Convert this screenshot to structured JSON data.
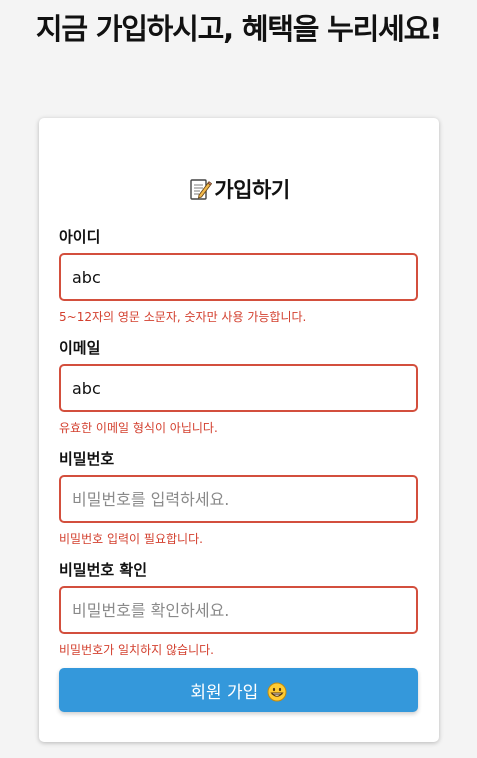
{
  "page": {
    "headline": "지금 가입하시고, 혜택을 누리세요!"
  },
  "signup_form": {
    "title_icon": "memo-icon",
    "title": "가입하기",
    "fields": [
      {
        "label": "아이디",
        "value": "abc",
        "placeholder": "",
        "error": "5~12자의 영문 소문자, 숫자만 사용 가능합니다."
      },
      {
        "label": "이메일",
        "value": "abc",
        "placeholder": "",
        "error": "유효한 이메일 형식이 아닙니다."
      },
      {
        "label": "비밀번호",
        "value": "",
        "placeholder": "비밀번호를 입력하세요.",
        "error": "비밀번호 입력이 필요합니다."
      },
      {
        "label": "비밀번호 확인",
        "value": "",
        "placeholder": "비밀번호를 확인하세요.",
        "error": "비밀번호가 일치하지 않습니다."
      }
    ],
    "submit_label": "회원 가입",
    "submit_icon": "grinning-face-icon"
  },
  "colors": {
    "background": "#f4f4f4",
    "card": "#ffffff",
    "error": "#d3402f",
    "error_border": "#d34f3d",
    "primary_button": "#3498db"
  }
}
